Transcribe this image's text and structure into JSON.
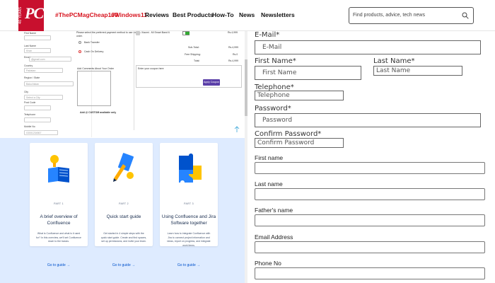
{
  "header": {
    "logo_text": "PC",
    "logo_years": "40 YEARS",
    "nav": [
      {
        "label": "#ThePCMagCheap100",
        "red": true
      },
      {
        "label": "#Windows11",
        "red": true
      },
      {
        "label": "Reviews",
        "red": false
      },
      {
        "label": "Best Products",
        "red": false
      },
      {
        "label": "How-To",
        "red": false
      },
      {
        "label": "News",
        "red": false
      },
      {
        "label": "Newsletters",
        "red": false
      }
    ],
    "search_placeholder": "Find products, advice, tech news"
  },
  "checkout": {
    "first_name_label": "First Name",
    "last_name_label": "Last Name",
    "last_name_value": "Khan",
    "email_label": "Email",
    "email_value": "@gmail.com",
    "country_label": "Country",
    "country_value": "Pakistan",
    "region_label": "Region / State",
    "region_value": "Baluchistan",
    "city_label": "City",
    "city_value": "Select a City",
    "post_code_label": "Post Code",
    "telephone_label": "Telephone",
    "mobile_label": "Mobile No",
    "mobile_value": "03001234567",
    "payment_prompt": "Please select the preferred payment method to use on this order.",
    "payment_options": [
      "Bank Transfer",
      "Cash On Delivery"
    ],
    "comments_label": "Add Comments About Your Order",
    "product_line": "Xiaomi - Mi Smart Band 6",
    "product_price": "Rs.4,999",
    "sub_total_label": "Sub-Total:",
    "sub_total_value": "Rs.4,999",
    "shipping_label": "Free Shipping:",
    "shipping_value": "Rs.0",
    "total_label": "Total:",
    "total_value": "Rs.4,999",
    "coupon_label": "Enter your coupon here",
    "apply_label": "Apply Coupon",
    "warning_text": "Add @ CUSTOM available only"
  },
  "confluence": {
    "cards": [
      {
        "part": "PART 1",
        "title": "A brief overview of Confluence",
        "desc": "What is Confluence and what is it used for? In this overview, we'll set Confluence down to the basics.",
        "link": "Go to guide →"
      },
      {
        "part": "PART 2",
        "title": "Quick start guide",
        "desc": "Get started in 4 simple steps with the quick start guide. Create and find spaces, set up permissions, and invite your team.",
        "link": "Go to guide →"
      },
      {
        "part": "PART 3",
        "title": "Using Confluence and Jira Software together",
        "desc": "Learn how to integrate Confluence with Jira to connect project information and ideas, report on progress, and integrate work items.",
        "link": "Go to guide →"
      }
    ]
  },
  "register": {
    "email_label": "E-Mail*",
    "email_placeholder": "E-Mail",
    "first_name_label": "First Name*",
    "first_name_placeholder": "First Name",
    "last_name_label": "Last Name*",
    "last_name_placeholder": "Last Name",
    "telephone_label": "Telephone*",
    "telephone_placeholder": "Telephone",
    "password_label": "Password*",
    "password_placeholder": "Password",
    "confirm_label": "Confirm Password*",
    "confirm_placeholder": "Confirm Password",
    "simple_fields": [
      "First name",
      "Last name",
      "Father's name",
      "Email Address",
      "Phone No"
    ]
  }
}
